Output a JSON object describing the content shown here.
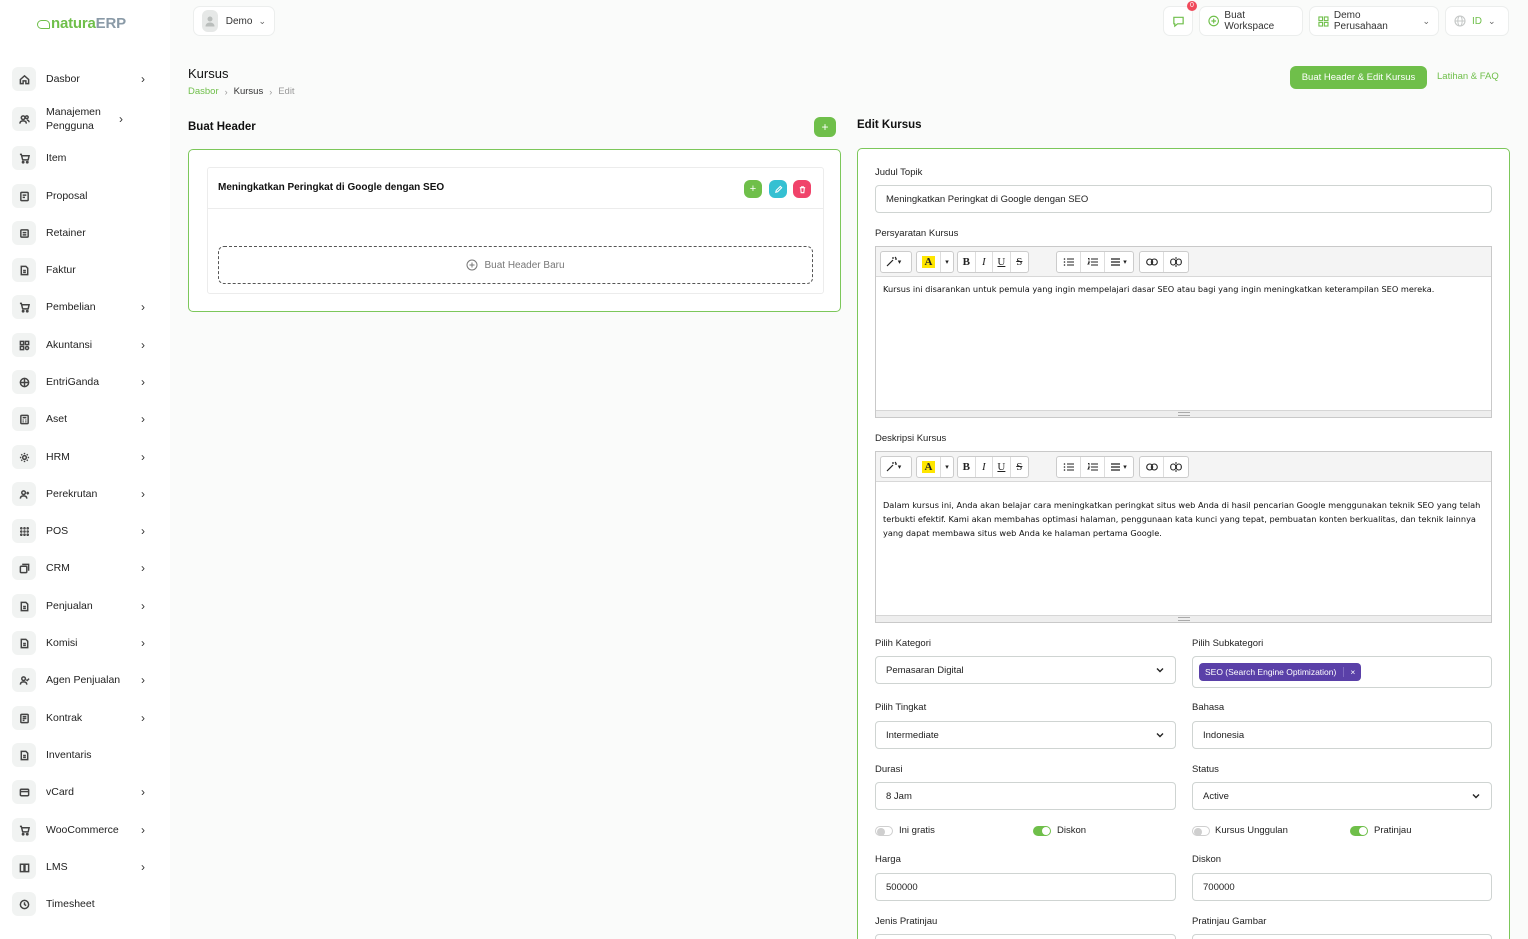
{
  "brand": {
    "name_a": "natura",
    "name_b": "ERP"
  },
  "sidebar": {
    "items": [
      {
        "label": "Dasbor",
        "icon": "home-icon",
        "chevron": true
      },
      {
        "label": "Manajemen Pengguna",
        "icon": "users-icon",
        "chevron": true
      },
      {
        "label": "Item",
        "icon": "cart-icon",
        "chevron": false
      },
      {
        "label": "Proposal",
        "icon": "proposal-icon",
        "chevron": false
      },
      {
        "label": "Retainer",
        "icon": "retainer-icon",
        "chevron": false
      },
      {
        "label": "Faktur",
        "icon": "invoice-icon",
        "chevron": false
      },
      {
        "label": "Pembelian",
        "icon": "cart-icon",
        "chevron": true
      },
      {
        "label": "Akuntansi",
        "icon": "grid-icon",
        "chevron": true
      },
      {
        "label": "EntriGanda",
        "icon": "scale-icon",
        "chevron": true
      },
      {
        "label": "Aset",
        "icon": "calculator-icon",
        "chevron": true
      },
      {
        "label": "HRM",
        "icon": "settings-icon",
        "chevron": true
      },
      {
        "label": "Perekrutan",
        "icon": "user-plus-icon",
        "chevron": true
      },
      {
        "label": "POS",
        "icon": "dots-grid-icon",
        "chevron": true
      },
      {
        "label": "CRM",
        "icon": "layers-icon",
        "chevron": true
      },
      {
        "label": "Penjualan",
        "icon": "file-icon",
        "chevron": true
      },
      {
        "label": "Komisi",
        "icon": "file-icon",
        "chevron": true
      },
      {
        "label": "Agen Penjualan",
        "icon": "user-check-icon",
        "chevron": true
      },
      {
        "label": "Kontrak",
        "icon": "contract-icon",
        "chevron": true
      },
      {
        "label": "Inventaris",
        "icon": "file-icon",
        "chevron": false
      },
      {
        "label": "vCard",
        "icon": "card-icon",
        "chevron": true
      },
      {
        "label": "WooCommerce",
        "icon": "cart-icon",
        "chevron": true
      },
      {
        "label": "LMS",
        "icon": "book-icon",
        "chevron": true
      },
      {
        "label": "Timesheet",
        "icon": "clock-icon",
        "chevron": false
      }
    ]
  },
  "topbar": {
    "user": "Demo",
    "notif_count": "0",
    "workspace_btn": "Buat Workspace",
    "company": "Demo Perusahaan",
    "lang": "ID"
  },
  "page": {
    "title": "Kursus",
    "breadcrumb": [
      "Dasbor",
      "Kursus",
      "Edit"
    ],
    "primary_btn": "Buat Header & Edit Kursus",
    "faq_link": "Latihan & FAQ"
  },
  "left": {
    "title": "Buat Header",
    "add_symbol": "+",
    "header_item": "Meningkatkan Peringkat di Google dengan SEO",
    "new_header_btn": "Buat Header Baru"
  },
  "form": {
    "title": "Edit Kursus",
    "topic_label": "Judul Topik",
    "topic_value": "Meningkatkan Peringkat di Google dengan SEO",
    "req_label": "Persyaratan Kursus",
    "req_text": "Kursus ini disarankan untuk pemula yang ingin mempelajari dasar SEO atau bagi yang ingin meningkatkan keterampilan SEO mereka.",
    "desc_label": "Deskripsi Kursus",
    "desc_text": "Dalam kursus ini, Anda akan belajar cara meningkatkan peringkat situs web Anda di hasil pencarian Google menggunakan teknik SEO yang telah terbukti efektif. Kami akan membahas optimasi halaman, penggunaan kata kunci yang tepat, pembuatan konten berkualitas, dan teknik lainnya yang dapat membawa situs web Anda ke halaman pertama Google.",
    "category_label": "Pilih Kategori",
    "category_value": "Pemasaran Digital",
    "subcategory_label": "Pilih Subkategori",
    "subcategory_tag": "SEO (Search Engine Optimization)",
    "subcategory_remove": "×",
    "level_label": "Pilih Tingkat",
    "level_value": "Intermediate",
    "lang_label": "Bahasa",
    "lang_value": "Indonesia",
    "duration_label": "Durasi",
    "duration_value": "8 Jam",
    "status_label": "Status",
    "status_value": "Active",
    "toggle_free": "Ini gratis",
    "toggle_discount": "Diskon",
    "toggle_featured": "Kursus Unggulan",
    "toggle_preview": "Pratinjau",
    "price_label": "Harga",
    "price_value": "500000",
    "discount_label": "Diskon",
    "discount_value": "700000",
    "preview_type_label": "Jenis Pratinjau",
    "preview_image_label": "Pratinjau Gambar",
    "toolbar": {
      "bold": "B",
      "italic": "I",
      "underline": "U",
      "strike": "S",
      "font_color": "A"
    }
  },
  "colors": {
    "accent": "#6fbf4a",
    "teal": "#35c0d2",
    "danger": "#f0436a",
    "tag": "#5a40a8"
  }
}
